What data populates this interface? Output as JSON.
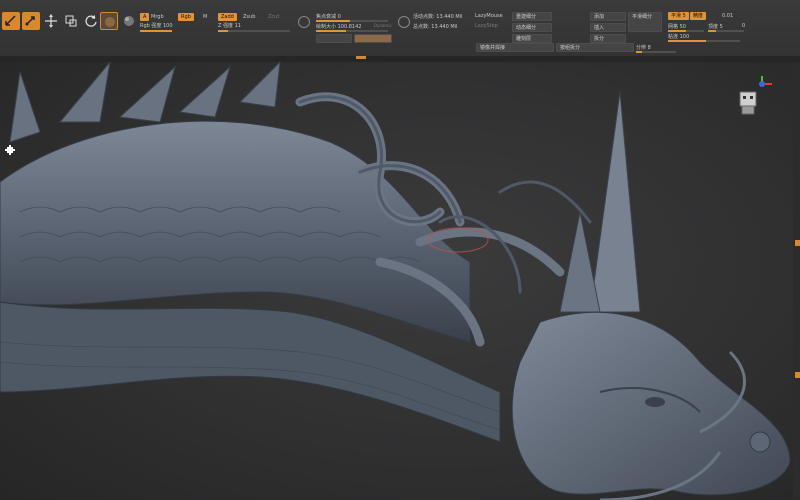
{
  "toolbar": {
    "tool_labels": [
      "",
      "",
      "",
      "",
      "",
      "",
      ""
    ],
    "mrgb": {
      "m_badge": "A",
      "label": "Mrgb",
      "sub_label": "Rgb 强度 100"
    },
    "rgb": {
      "badge": "Rgb",
      "m": "M"
    },
    "zadd": {
      "badge": "Zadd",
      "zsub": "Zsub",
      "zcut": "Zcut",
      "intensity": "Z 强度 11"
    },
    "focal": {
      "label": "焦点衰减 0",
      "draw_size": "绘制大小 100.8142",
      "dynamic": "Dynamic"
    },
    "active_points": {
      "label": "活动点数: 13.440 Mil",
      "lazy": "LazyMouse",
      "total": "总点数: 13.440 Mil",
      "lazy_step": "LazyStep"
    },
    "buttons": {
      "reconstruct": "重建细分",
      "dynamic_sub": "动态细分",
      "sculpt": "雕刻层",
      "add": "添加",
      "insert": "插入",
      "split": "拆分",
      "smooth_sub": "平滑细分",
      "mirror_weld": "镜像并焊接",
      "replace_geom": "按组拆分",
      "zremesh": "ZRemesher",
      "target": "目标",
      "resolution": "分辨率",
      "surface": "表面节",
      "apply": "面积化",
      "div": "细分"
    },
    "right": {
      "smooth_badge": "平滑 5",
      "poly": "精度",
      "poly_val": "0.01",
      "grid": "网格 50",
      "val5": "顶度 5",
      "radius": "粘连 100",
      "circle_val": "0",
      "coverage": "分辨 8"
    }
  },
  "colors": {
    "accent": "#e09437",
    "panel": "#383838",
    "viewport": "#2f2f30",
    "model": "#5f6a7a"
  },
  "icons": [
    "brush-icon",
    "move-icon",
    "scale-icon",
    "rotate-icon",
    "gizmo-icon",
    "material-icon",
    "sphere-icon",
    "axis-gizmo-icon",
    "view-cube-icon"
  ]
}
